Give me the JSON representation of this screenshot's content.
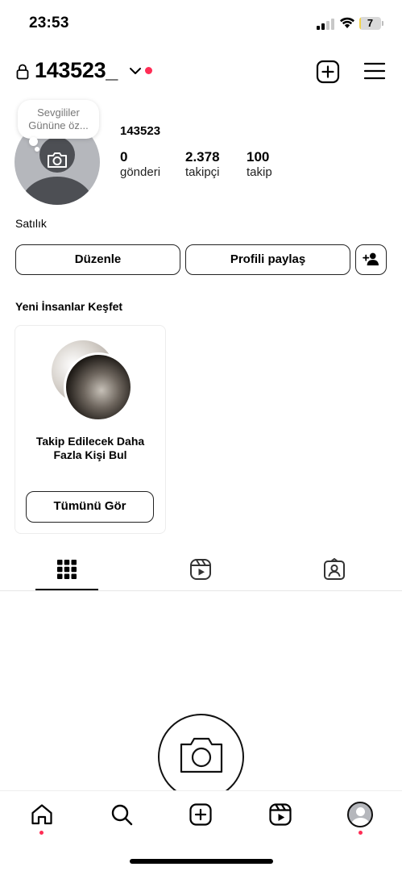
{
  "status_bar": {
    "time": "23:53",
    "battery_level": "7",
    "signal_bars_active": 2,
    "signal_bars_total": 4,
    "battery_fill_fraction": 0.07,
    "battery_color": "#f2d34a"
  },
  "header": {
    "username": "143523_",
    "lock_icon": "lock-icon",
    "switch_icon": "chevron-down-icon",
    "new_post_icon": "plus-square-icon",
    "menu_icon": "hamburger-menu-icon",
    "notification_dot_color": "#ff2d55"
  },
  "profile": {
    "note_line1": "Sevgililer",
    "note_line2": "Gününe öz...",
    "display_name": "143523",
    "stats": {
      "posts_value": "0",
      "posts_label": "gönderi",
      "followers_value": "2.378",
      "followers_label": "takipçi",
      "following_value": "100",
      "following_label": "takip"
    },
    "bio": "Satılık",
    "avatar_icon": "camera-icon"
  },
  "actions": {
    "edit_label": "Düzenle",
    "share_label": "Profili paylaş",
    "add_user_icon": "person-plus-icon"
  },
  "discover": {
    "title": "Yeni İnsanlar Keşfet",
    "card_text": "Takip Edilecek Daha Fazla Kişi Bul",
    "see_all_label": "Tümünü Gör"
  },
  "tabs": {
    "items": [
      "grid-icon",
      "reels-icon",
      "tagged-icon"
    ],
    "active": "grid-icon"
  },
  "empty_state": {
    "icon": "camera-icon"
  },
  "bottom_nav": {
    "items": [
      "home-icon",
      "search-icon",
      "create-icon",
      "reels-icon",
      "profile-avatar"
    ],
    "active": "profile-avatar"
  }
}
